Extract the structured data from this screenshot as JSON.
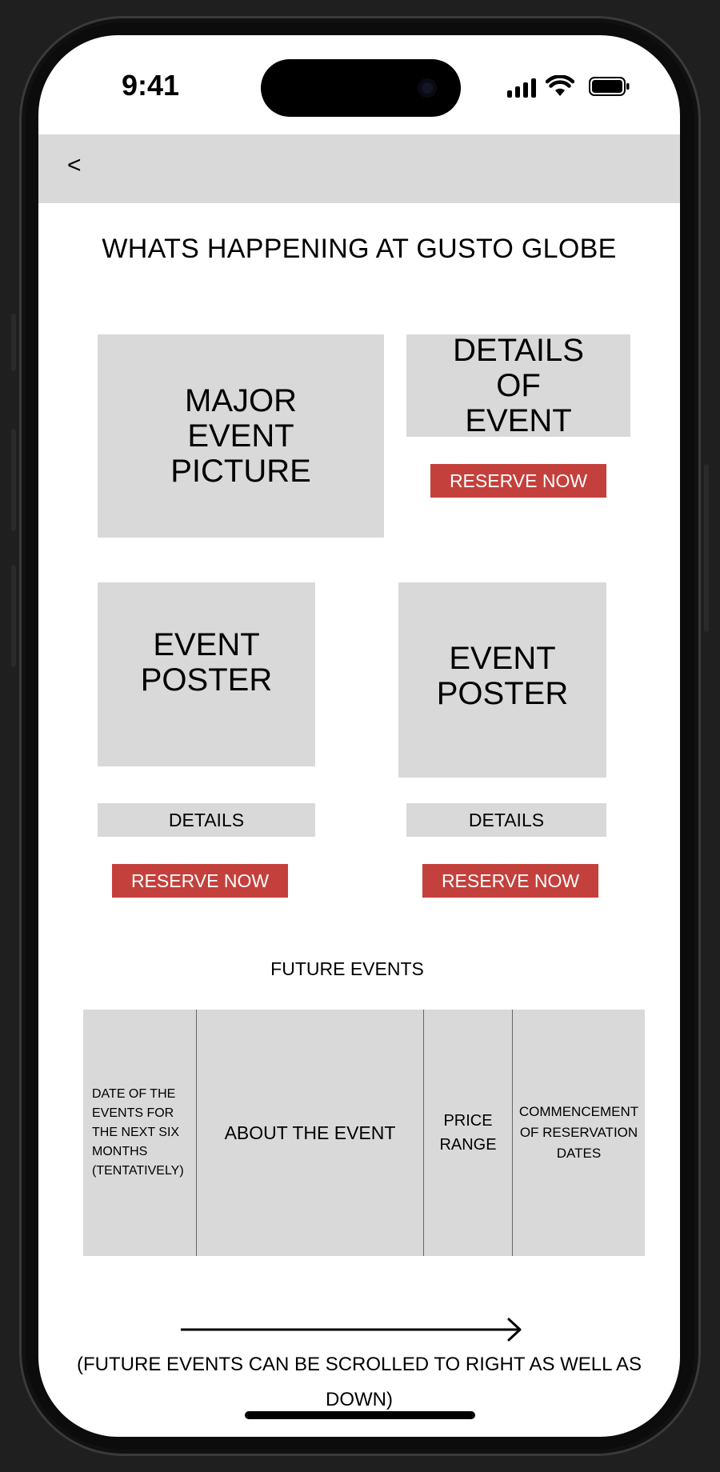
{
  "status_bar": {
    "time": "9:41"
  },
  "header": {
    "back_label": "<"
  },
  "page": {
    "title": "WHATS HAPPENING AT GUSTO GLOBE"
  },
  "major_event": {
    "picture_label": "MAJOR EVENT PICTURE",
    "details_label": "DETAILS OF EVENT",
    "reserve_label": "RESERVE NOW"
  },
  "events": [
    {
      "poster_label": "EVENT POSTER",
      "details_label": "DETAILS",
      "reserve_label": "RESERVE NOW"
    },
    {
      "poster_label": "EVENT POSTER",
      "details_label": "DETAILS",
      "reserve_label": "RESERVE NOW"
    }
  ],
  "future_events": {
    "title": "FUTURE EVENTS",
    "columns": [
      "DATE OF THE EVENTS FOR THE NEXT SIX MONTHS (TENTATIVELY)",
      "ABOUT THE EVENT",
      "PRICE RANGE",
      "COMMENCEMENT OF RESERVATION DATES"
    ],
    "footnote": "(FUTURE EVENTS CAN BE SCROLLED TO RIGHT AS WELL AS DOWN)"
  },
  "colors": {
    "accent_red": "#c4403c",
    "placeholder_gray": "#d9d9d9",
    "header_gray": "#d9d9d9"
  }
}
